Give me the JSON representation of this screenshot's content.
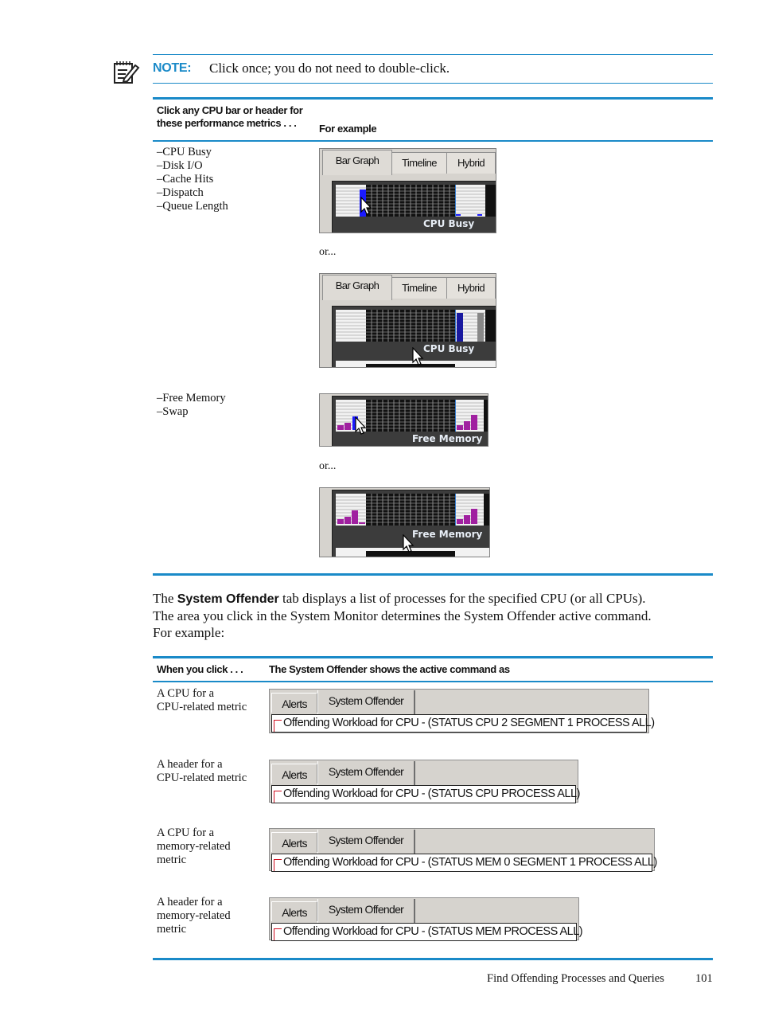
{
  "note": {
    "icon": "note-pencil-icon",
    "label": "NOTE:",
    "text": "Click once; you do not need to double-click."
  },
  "metrics_table": {
    "header_col1_line1": "Click any CPU bar or header for",
    "header_col1_line2": "these performance metrics . . .",
    "header_col2": "For example",
    "rows": [
      {
        "metrics": [
          "–CPU Busy",
          "–Disk I/O",
          "–Cache Hits",
          "–Dispatch",
          "–Queue Length"
        ],
        "examples": [
          {
            "tabs": [
              "Bar Graph",
              "Timeline",
              "Hybrid"
            ],
            "caption": "CPU Busy",
            "click_target": "bar"
          },
          {
            "tabs": [
              "Bar Graph",
              "Timeline",
              "Hybrid"
            ],
            "caption": "CPU Busy",
            "click_target": "header"
          }
        ]
      },
      {
        "metrics": [
          "–Free Memory",
          "–Swap"
        ],
        "examples": [
          {
            "caption": "Free Memory",
            "click_target": "bar"
          },
          {
            "caption": "Free Memory",
            "click_target": "header"
          }
        ]
      }
    ],
    "or_label": "or..."
  },
  "body": {
    "prefix": "The ",
    "bold": "System Offender",
    "rest_line1": " tab displays a list of processes for the specified CPU (or all CPUs).",
    "line2": "The area you click in the System Monitor determines the System Offender active command.",
    "line3": "For example:"
  },
  "offender_table": {
    "header_col1": "When you click . . .",
    "header_col2": "The System Offender shows the active command as",
    "tabs": {
      "alerts": "Alerts",
      "system_offender": "System Offender"
    },
    "rows": [
      {
        "when": [
          "A CPU for a",
          "CPU-related metric"
        ],
        "command": "Offending Workload for CPU - (STATUS CPU 2 SEGMENT 1 PROCESS ALL)"
      },
      {
        "when": [
          "A header for a",
          "CPU-related metric"
        ],
        "command": "Offending Workload for CPU - (STATUS CPU PROCESS ALL)"
      },
      {
        "when": [
          "A CPU for a",
          "memory-related",
          "metric"
        ],
        "command": "Offending Workload for CPU - (STATUS MEM 0 SEGMENT 1 PROCESS ALL)"
      },
      {
        "when": [
          "A header for a",
          "memory-related",
          "metric"
        ],
        "command": "Offending Workload for CPU - (STATUS MEM PROCESS ALL)"
      }
    ]
  },
  "footer": {
    "section": "Find Offending Processes and Queries",
    "page": "101"
  },
  "colors": {
    "accent_rule": "#1a8ac8",
    "cpu_bar": "#1a1aff",
    "memory_bar": "#a020a0"
  }
}
